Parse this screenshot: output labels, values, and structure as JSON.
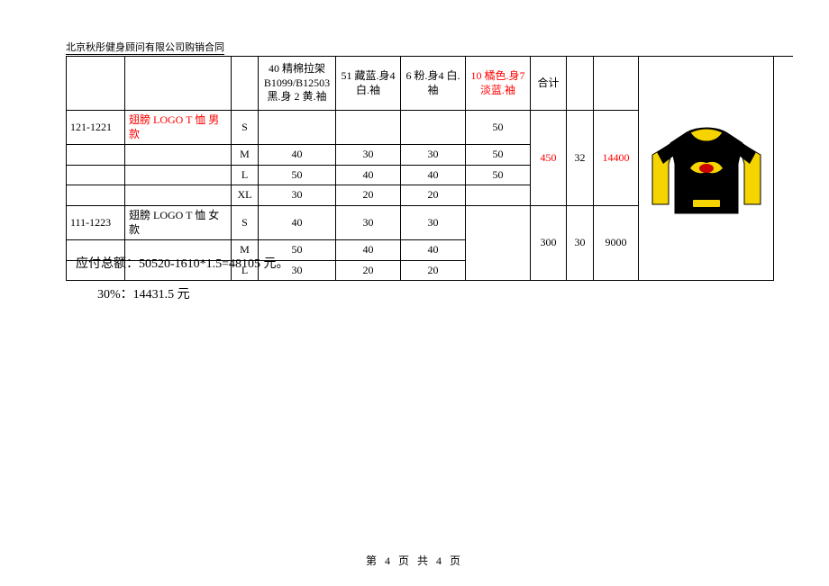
{
  "header": "北京秋彤健身顾问有限公司购销合同",
  "table": {
    "headers": [
      "",
      "",
      "",
      "40 精棉拉架B1099/B12503 黑.身 2 黄.袖",
      "51 藏蓝.身4 白.袖",
      "6 粉.身4 白.袖",
      "10 橘色.身7 淡蓝.袖",
      "合计",
      "",
      ""
    ],
    "groups": [
      {
        "code": "121-1221",
        "name": "翅膀 LOGO T 恤 男款",
        "rows": [
          {
            "size": "S",
            "v1": "",
            "v2": "",
            "v3": "",
            "v4": "50"
          },
          {
            "size": "M",
            "v1": "40",
            "v2": "30",
            "v3": "30",
            "v4": "50"
          },
          {
            "size": "L",
            "v1": "50",
            "v2": "40",
            "v3": "40",
            "v4": "50"
          },
          {
            "size": "XL",
            "v1": "30",
            "v2": "20",
            "v3": "20",
            "v4": ""
          }
        ],
        "total": "450",
        "price": "32",
        "amount": "14400"
      },
      {
        "code": "111-1223",
        "name": "翅膀 LOGO T 恤 女款",
        "rows": [
          {
            "size": "S",
            "v1": "40",
            "v2": "30",
            "v3": "30",
            "v4": ""
          },
          {
            "size": "M",
            "v1": "50",
            "v2": "40",
            "v3": "40",
            "v4": ""
          },
          {
            "size": "L",
            "v1": "30",
            "v2": "20",
            "v3": "20",
            "v4": ""
          }
        ],
        "total": "300",
        "price": "30",
        "amount": "9000"
      }
    ]
  },
  "notes": {
    "line1": "应付总额：50520-1610*1.5=48105 元。",
    "line2": "30%：14431.5 元"
  },
  "footer": "第 4 页 共 4 页"
}
